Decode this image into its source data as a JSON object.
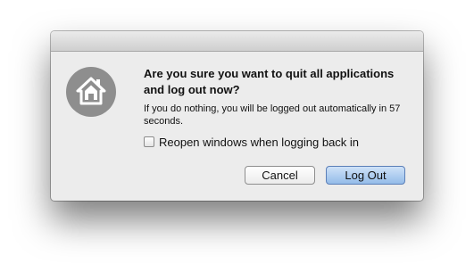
{
  "dialog": {
    "title": "Are you sure you want to quit all applications and log out now?",
    "message": "If you do nothing, you will be logged out automatically in 57 seconds.",
    "checkbox": {
      "label": "Reopen windows when logging back in",
      "checked": false
    },
    "buttons": {
      "cancel": "Cancel",
      "logout": "Log Out"
    },
    "icon": "home-icon",
    "colors": {
      "icon_circle": "#8e8e8e",
      "default_button": "#94bce9"
    }
  }
}
